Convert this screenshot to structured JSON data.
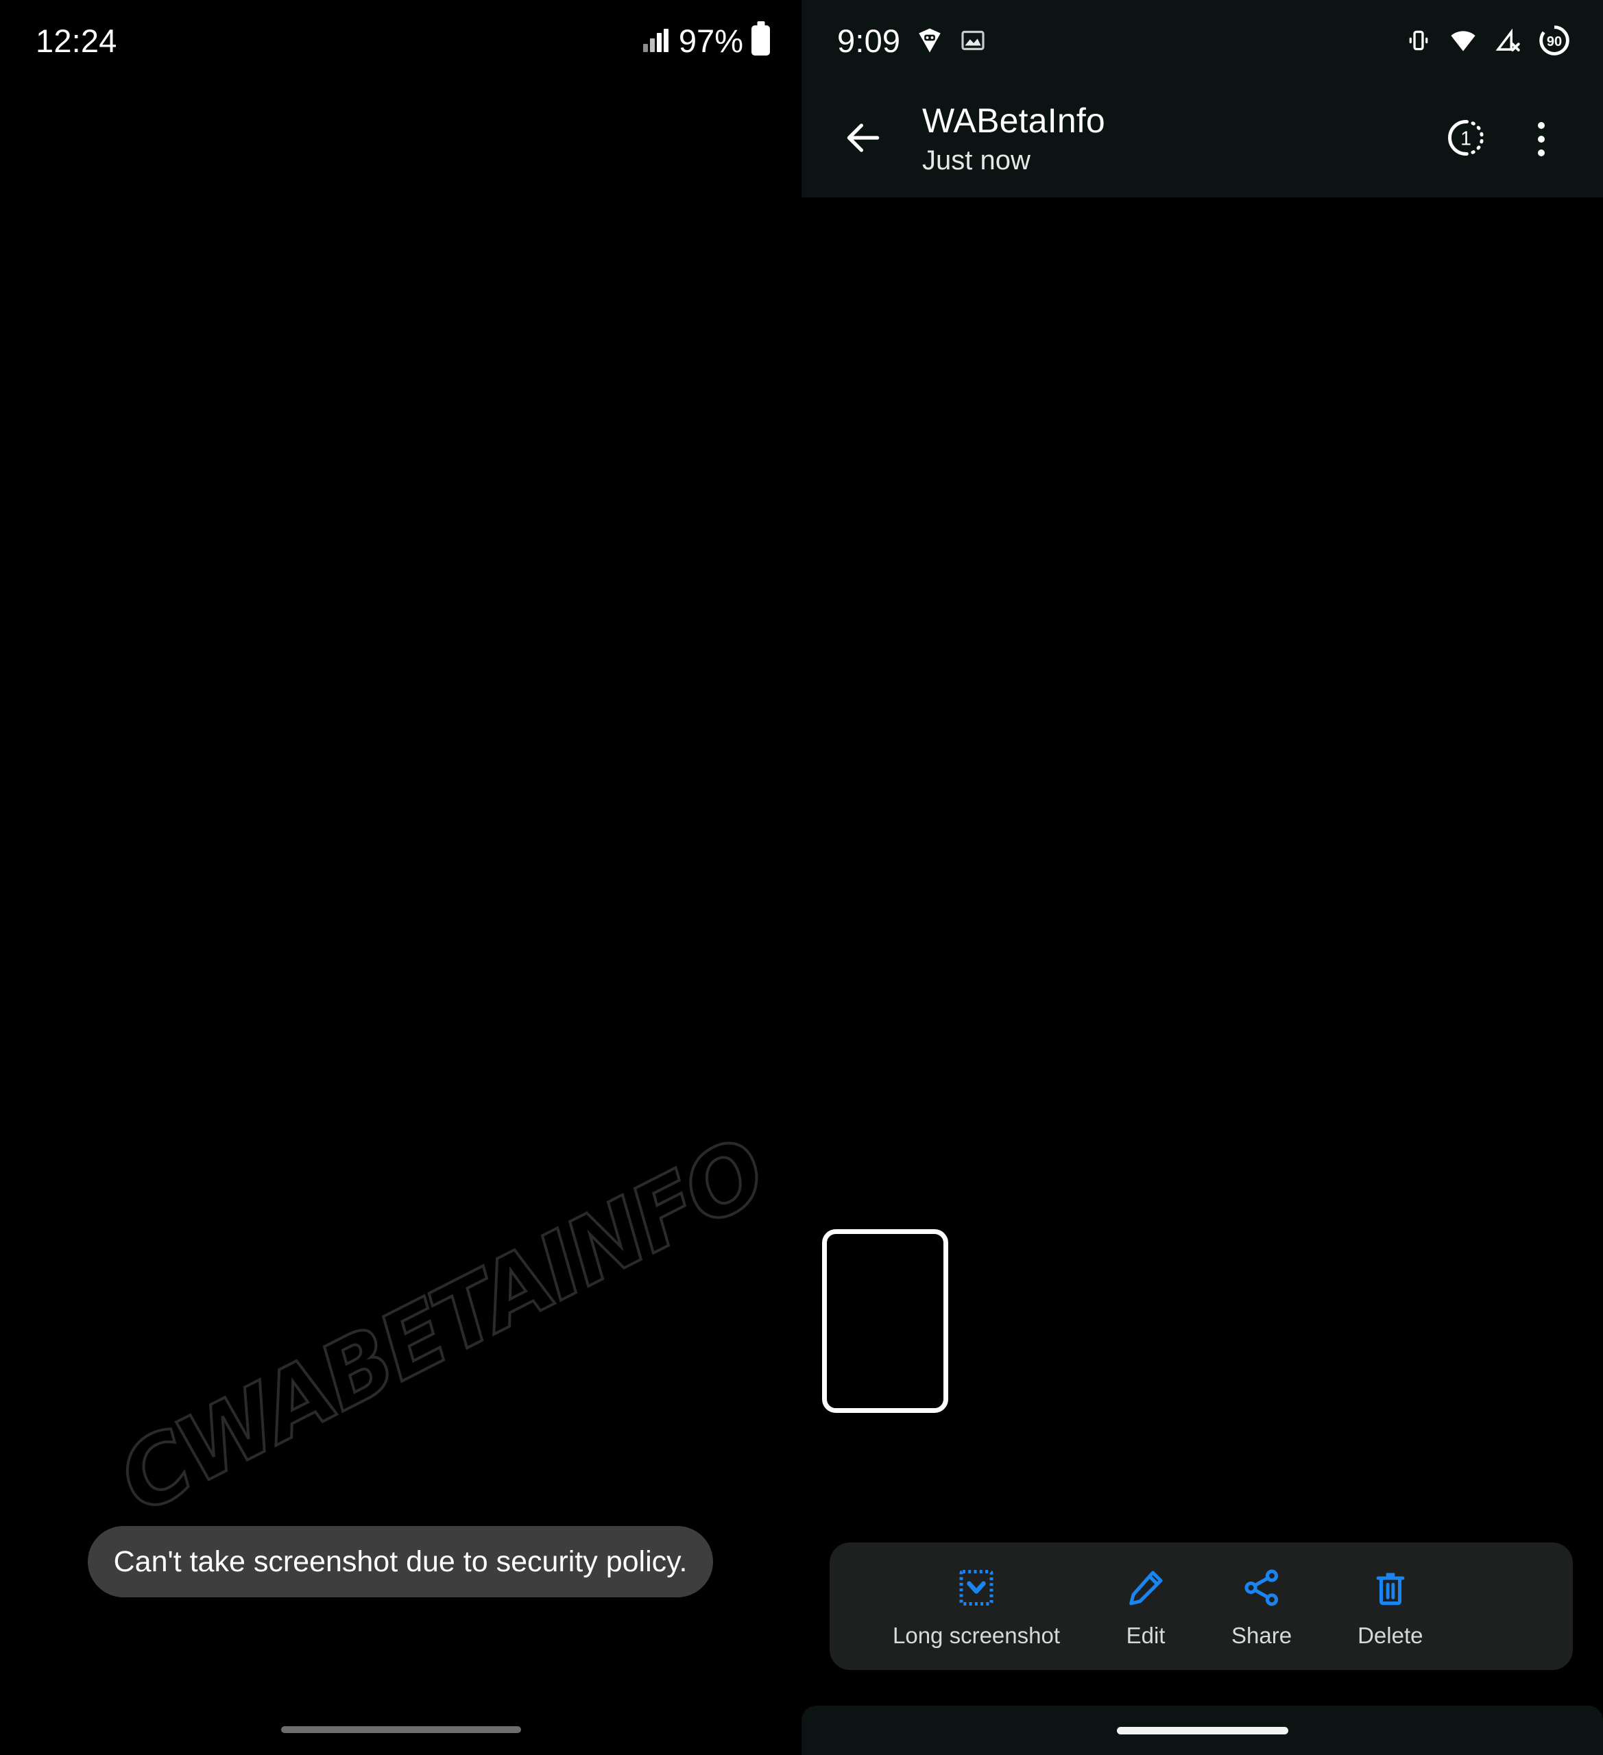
{
  "left_panel": {
    "status_bar": {
      "time": "12:24",
      "battery_percent": "97%",
      "icons": [
        "signal-bars-icon",
        "battery-icon"
      ]
    },
    "toast": {
      "message": "Can't take screenshot due to security policy."
    },
    "watermark": {
      "text": "CWABETAINFO"
    },
    "nav": {
      "gesture_pill": "home-gesture-pill"
    }
  },
  "right_panel": {
    "status_bar": {
      "time": "9:09",
      "battery_percent": "90",
      "icons": [
        "vpn-shield-icon",
        "photo-icon",
        "vibrate-icon",
        "wifi-icon",
        "signal-off-icon",
        "battery-circle-icon"
      ]
    },
    "header": {
      "back_icon": "back-arrow-icon",
      "title": "WABetaInfo",
      "subtitle": "Just now",
      "view_once_badge": "1",
      "view_once_icon": "view-once-icon",
      "overflow_icon": "more-vert-icon"
    },
    "screenshot_preview": {
      "label": "screenshot-thumbnail"
    },
    "screenshot_toolbar": {
      "items": [
        {
          "label": "Long screenshot",
          "icon": "long-screenshot-icon"
        },
        {
          "label": "Edit",
          "icon": "pencil-icon"
        },
        {
          "label": "Share",
          "icon": "share-icon"
        },
        {
          "label": "Delete",
          "icon": "trash-icon"
        }
      ],
      "accent_color": "#1a85f0",
      "panel_color": "#1e2020"
    },
    "nav": {
      "gesture_pill": "home-gesture-pill"
    }
  }
}
